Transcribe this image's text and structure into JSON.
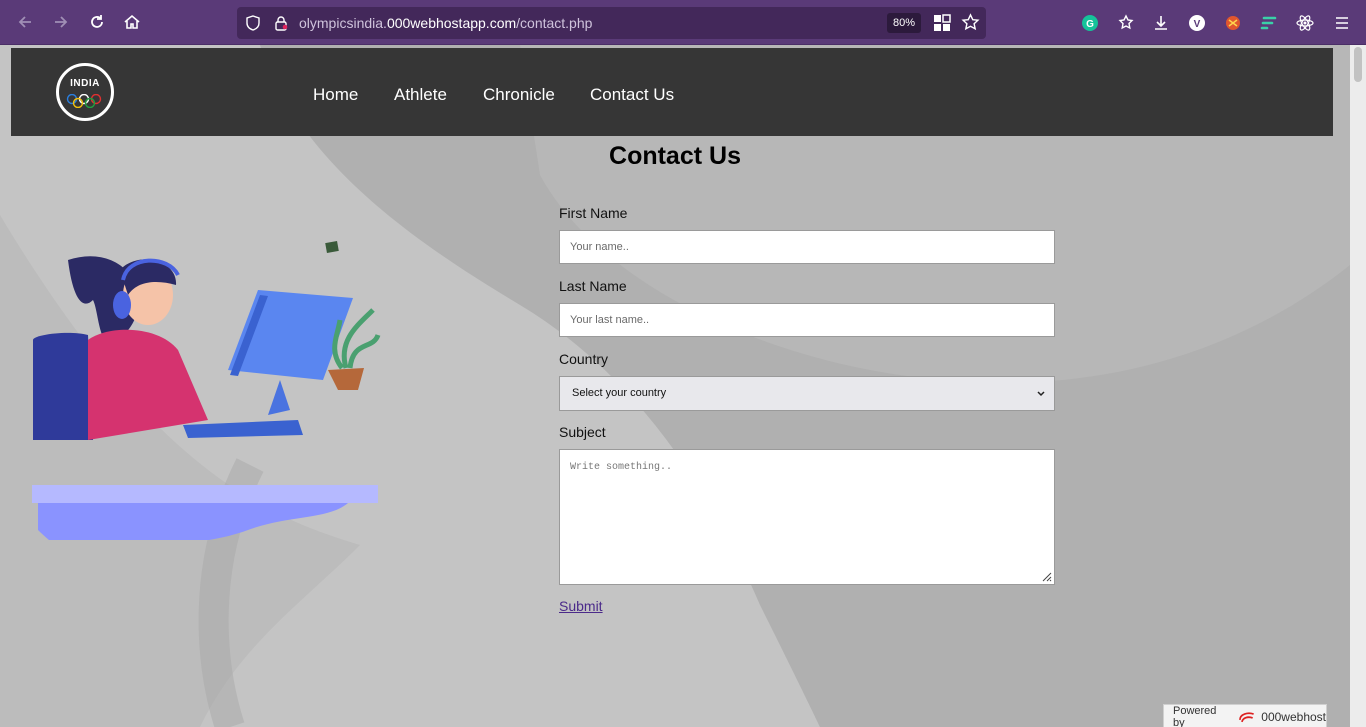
{
  "browser": {
    "url_prefix": "olympicsindia.",
    "url_host": "000webhostapp.com",
    "url_path": "/contact.php",
    "zoom": "80%",
    "icons": [
      "back-icon",
      "forward-icon",
      "reload-icon",
      "home-icon",
      "shield-icon",
      "lock-icon",
      "qr-icon",
      "star-icon",
      "grammarly-icon",
      "pocket-icon",
      "download-icon",
      "vpn-icon",
      "extension-icon",
      "flow-icon",
      "react-icon",
      "menu-icon"
    ]
  },
  "site": {
    "logo_text": "INDIA",
    "nav": [
      "Home",
      "Athlete",
      "Chronicle",
      "Contact Us"
    ]
  },
  "contact": {
    "title": "Contact Us",
    "first_name_label": "First Name",
    "first_name_placeholder": "Your name..",
    "last_name_label": "Last Name",
    "last_name_placeholder": "Your last name..",
    "country_label": "Country",
    "country_selected": "Select your country",
    "subject_label": "Subject",
    "subject_placeholder": "Write something..",
    "submit_label": "Submit"
  },
  "footer": {
    "powered_by": "Powered by",
    "brand": "000webhost"
  },
  "colors": {
    "browser_bar": "#5a3a78",
    "navbar": "#363636",
    "page_bg": "#b3b3b3",
    "link": "#4b2a8a"
  }
}
